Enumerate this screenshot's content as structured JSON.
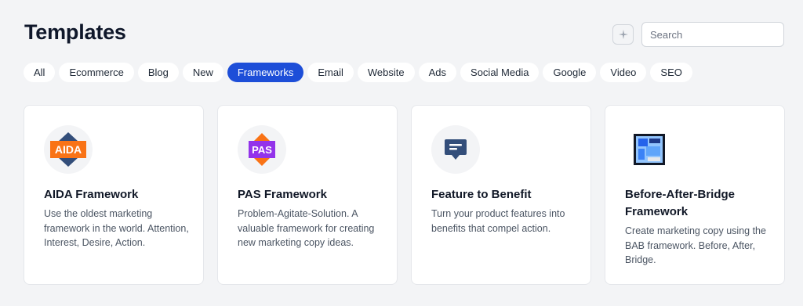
{
  "header": {
    "title": "Templates",
    "search_placeholder": "Search",
    "sparkle_icon": "sparkle-icon"
  },
  "filters": [
    {
      "label": "All",
      "active": false
    },
    {
      "label": "Ecommerce",
      "active": false
    },
    {
      "label": "Blog",
      "active": false
    },
    {
      "label": "New",
      "active": false
    },
    {
      "label": "Frameworks",
      "active": true
    },
    {
      "label": "Email",
      "active": false
    },
    {
      "label": "Website",
      "active": false
    },
    {
      "label": "Ads",
      "active": false
    },
    {
      "label": "Social Media",
      "active": false
    },
    {
      "label": "Google",
      "active": false
    },
    {
      "label": "Video",
      "active": false
    },
    {
      "label": "SEO",
      "active": false
    }
  ],
  "cards": [
    {
      "title": "AIDA Framework",
      "badge": "AIDA",
      "icon": "aida-badge-icon",
      "description": "Use the oldest marketing framework in the world. Attention, Interest, Desire, Action."
    },
    {
      "title": "PAS Framework",
      "badge": "PAS",
      "icon": "pas-badge-icon",
      "description": "Problem-Agitate-Solution. A valuable framework for creating new marketing copy ideas."
    },
    {
      "title": "Feature to Benefit",
      "icon": "message-icon",
      "description": "Turn your product features into benefits that compel action."
    },
    {
      "title": "Before-After-Bridge Framework",
      "icon": "window-collage-icon",
      "description": "Create marketing copy using the BAB framework. Before, After, Bridge."
    }
  ],
  "colors": {
    "accent": "#1d4ed8",
    "background": "#f3f4f6",
    "aida_orange": "#f97316",
    "pas_purple": "#9333ea",
    "message_blue": "#334e7a"
  }
}
